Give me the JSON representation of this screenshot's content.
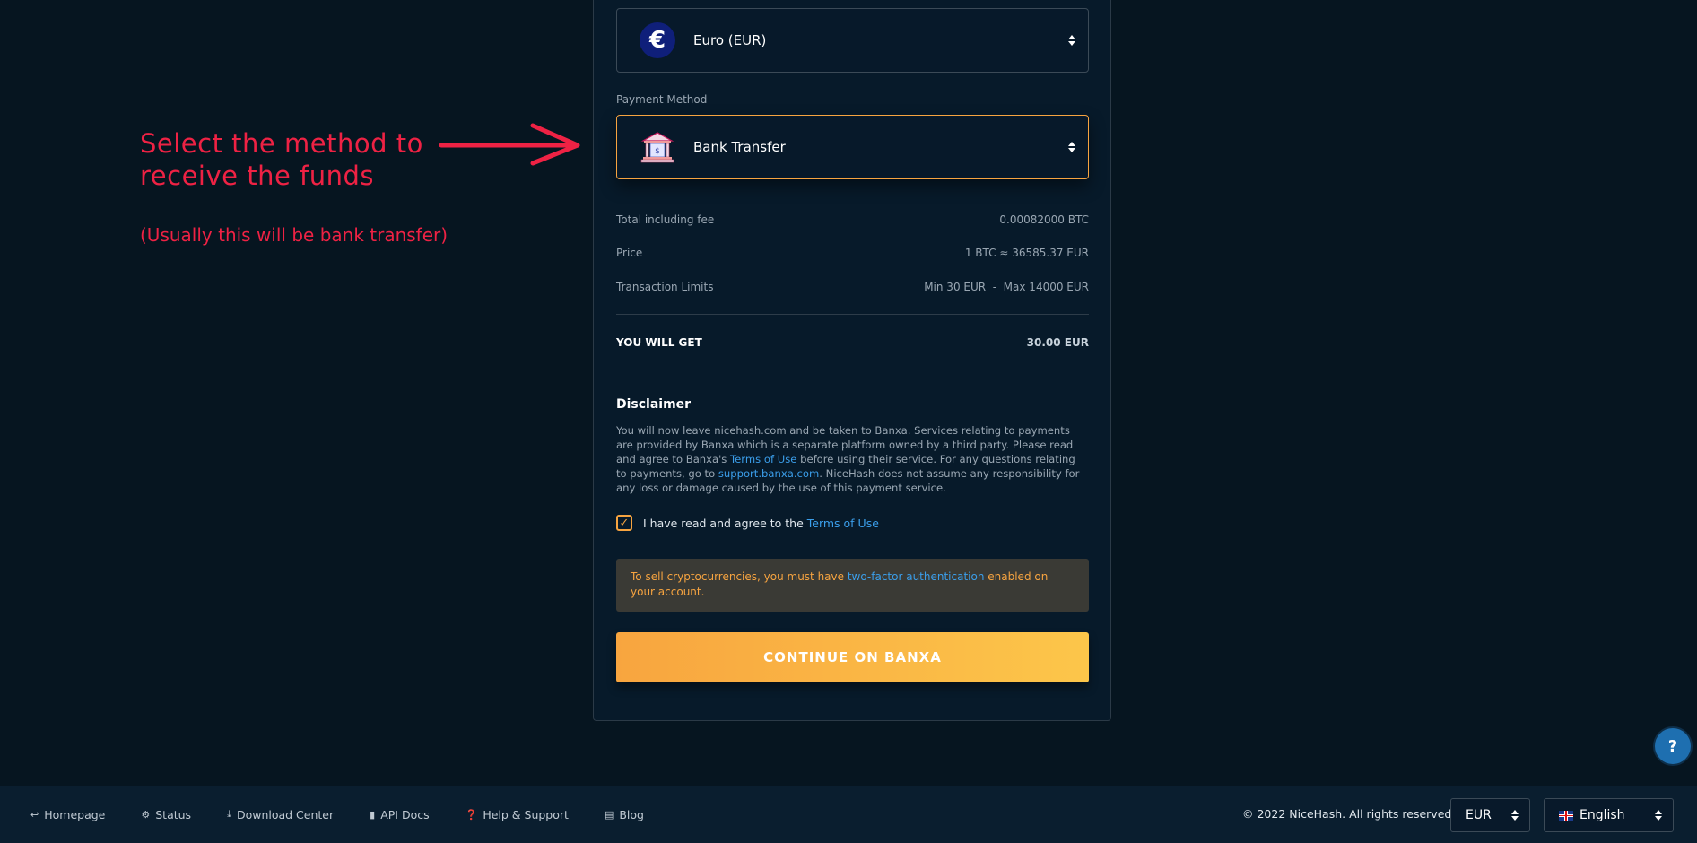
{
  "annotation": {
    "title_line1": "Select the method to",
    "title_line2": "receive the funds",
    "subtitle": "(Usually this will be bank transfer)"
  },
  "currency_select": {
    "symbol": "€",
    "value": "Euro (EUR)"
  },
  "payment_method": {
    "label": "Payment Method",
    "value": "Bank Transfer"
  },
  "summary": {
    "total_label": "Total including fee",
    "total_value": "0.00082000 BTC",
    "price_label": "Price",
    "price_value": "1 BTC ≈ 36585.37 EUR",
    "limits_label": "Transaction Limits",
    "limits_value": "Min 30 EUR  -  Max 14000 EUR",
    "get_label": "YOU WILL GET",
    "get_value": "30.00 EUR"
  },
  "disclaimer": {
    "title": "Disclaimer",
    "text_1": "You will now leave nicehash.com and be taken to Banxa. Services relating to payments are provided by Banxa which is a separate platform owned by a third party. Please read and agree to Banxa's ",
    "terms_link": "Terms of Use",
    "text_2": " before using their service. For any questions relating to payments, go to ",
    "support_link": "support.banxa.com",
    "text_3": ". NiceHash does not assume any responsibility for any loss or damage caused by the use of this payment service."
  },
  "agree": {
    "text": "I have read and agree to the ",
    "link": "Terms of Use",
    "checked": true
  },
  "warning": {
    "text_1": "To sell cryptocurrencies, you must have ",
    "link": "two-factor authentication",
    "text_2": " enabled on your account."
  },
  "cta": {
    "label": "CONTINUE ON BANXA"
  },
  "help": {
    "label": "?"
  },
  "footer": {
    "links": [
      {
        "label": "Homepage",
        "icon": "back-arrow-icon"
      },
      {
        "label": "Status",
        "icon": "gears-icon"
      },
      {
        "label": "Download Center",
        "icon": "download-icon"
      },
      {
        "label": "API Docs",
        "icon": "book-icon"
      },
      {
        "label": "Help & Support",
        "icon": "question-circle-icon"
      },
      {
        "label": "Blog",
        "icon": "newspaper-icon"
      }
    ],
    "copyright": "© 2022 NiceHash. All rights reserved",
    "currency": "EUR",
    "language": "English"
  },
  "colors": {
    "accent": "#f7a440",
    "link": "#3b9eea",
    "annotation": "#ee2244",
    "background": "#061520"
  }
}
